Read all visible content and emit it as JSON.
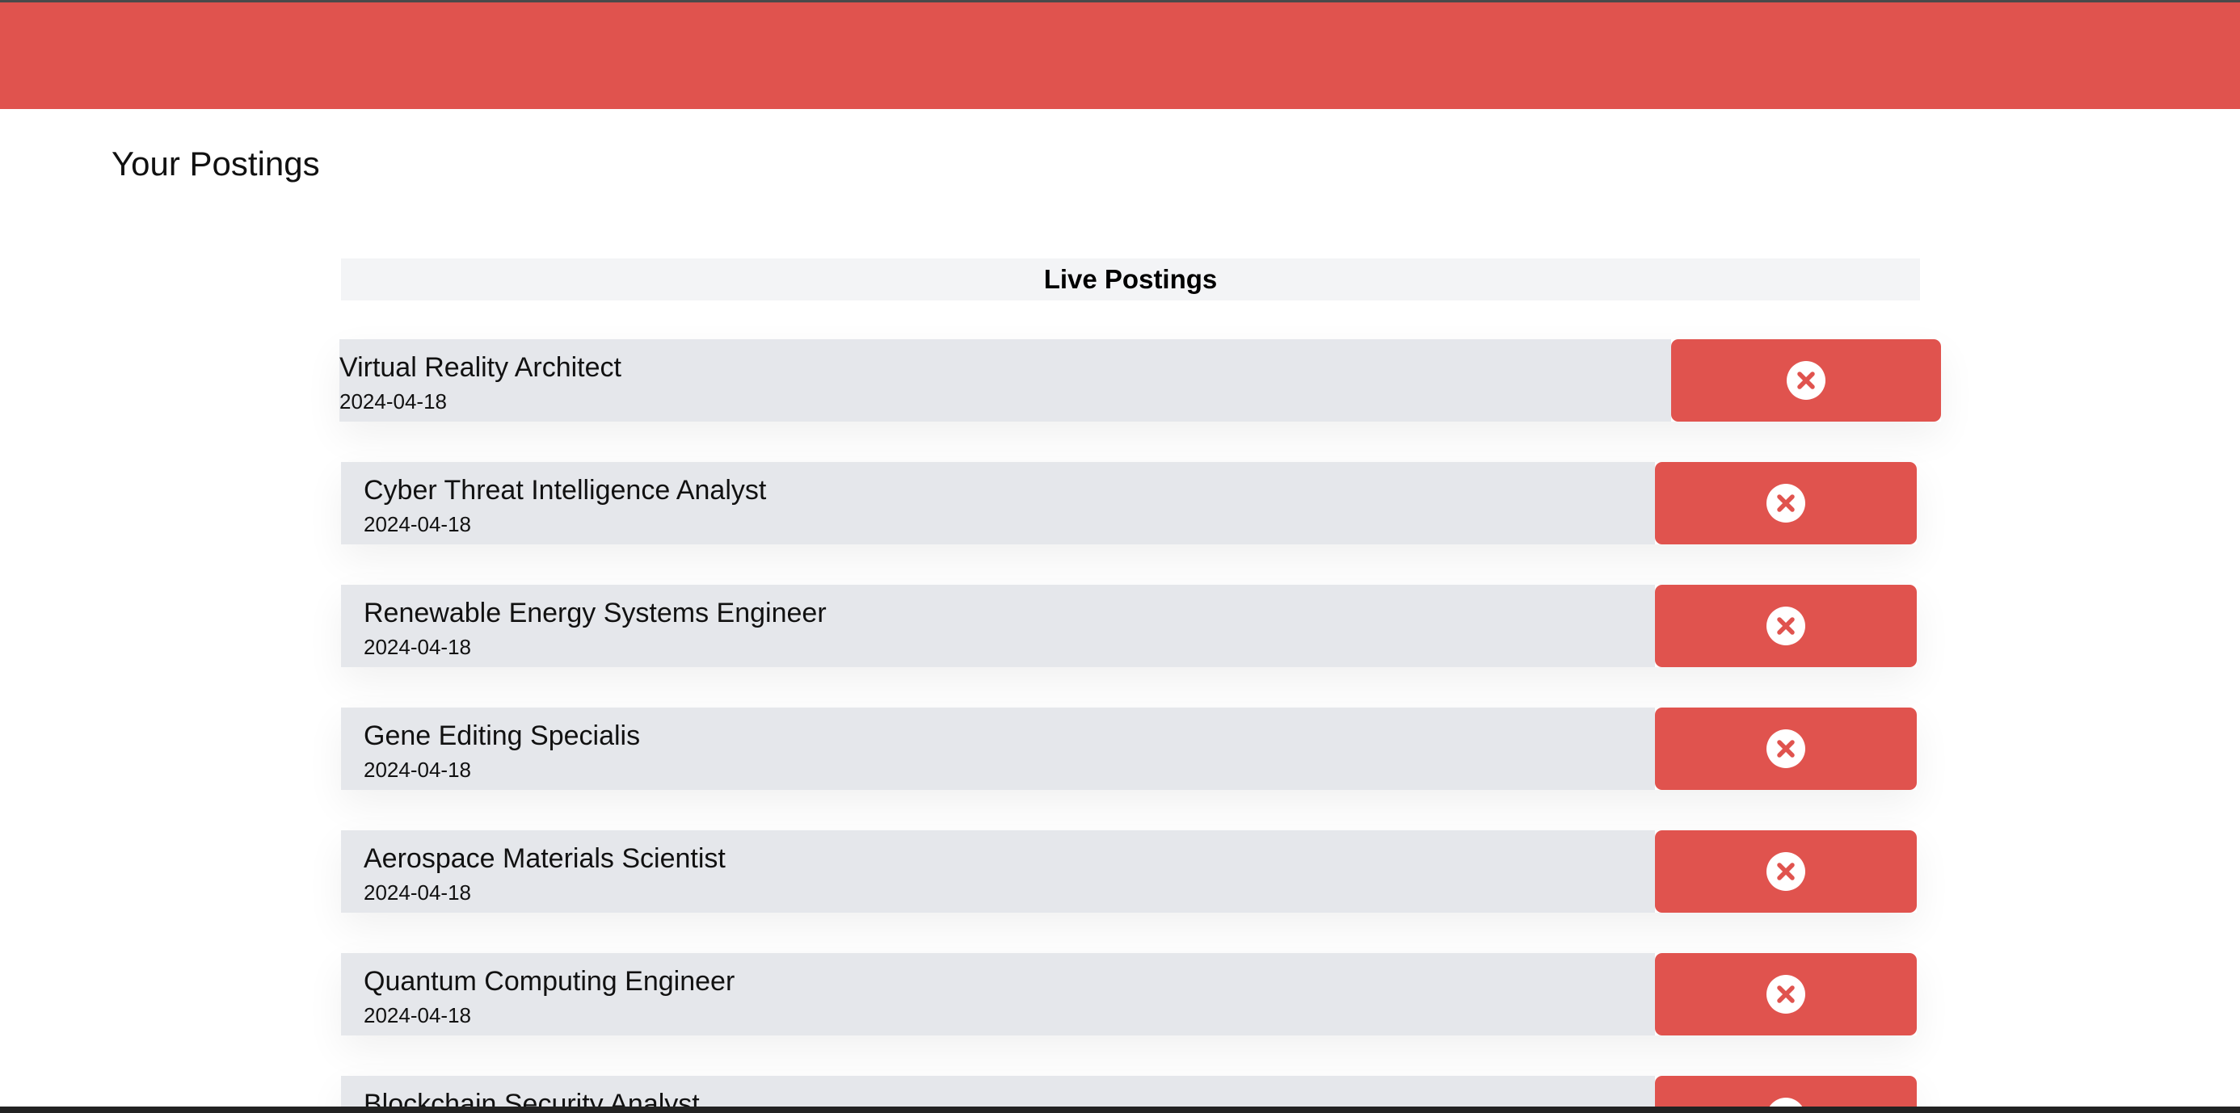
{
  "page": {
    "title": "Your Postings",
    "accent_color": "#e0534e"
  },
  "section": {
    "label": "Live Postings"
  },
  "postings": [
    {
      "title": "Virtual Reality Architect",
      "date": "2024-04-18",
      "action_icon": "close-circle-icon"
    },
    {
      "title": "Cyber Threat Intelligence Analyst",
      "date": "2024-04-18",
      "action_icon": "close-circle-icon"
    },
    {
      "title": "Renewable Energy Systems Engineer",
      "date": "2024-04-18",
      "action_icon": "close-circle-icon"
    },
    {
      "title": "Gene Editing Specialis",
      "date": "2024-04-18",
      "action_icon": "close-circle-icon"
    },
    {
      "title": "Aerospace Materials Scientist",
      "date": "2024-04-18",
      "action_icon": "close-circle-icon"
    },
    {
      "title": "Quantum Computing Engineer",
      "date": "2024-04-18",
      "action_icon": "close-circle-icon"
    },
    {
      "title": "Blockchain Security Analyst",
      "date": "",
      "action_icon": "close-circle-icon"
    }
  ]
}
